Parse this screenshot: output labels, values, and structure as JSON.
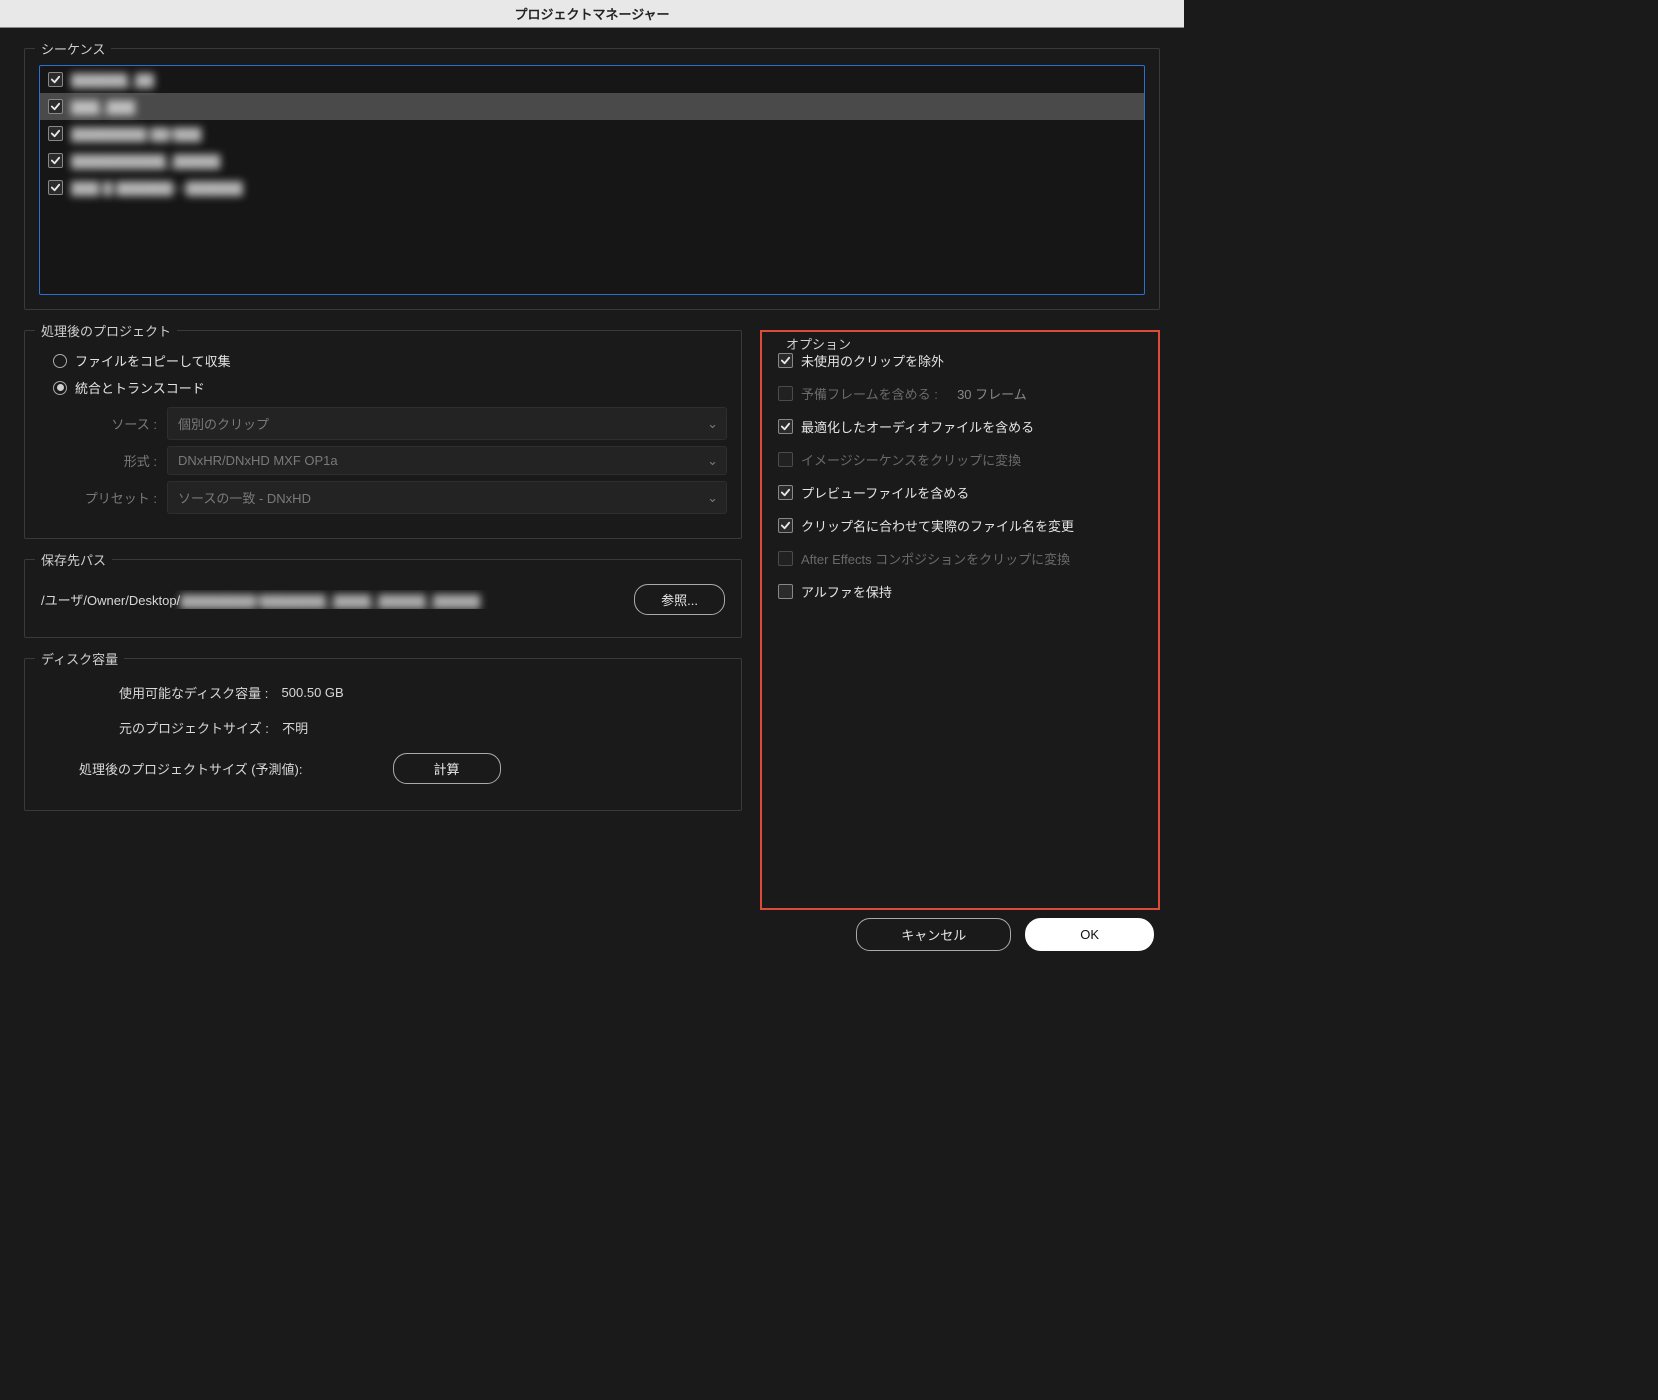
{
  "title": "プロジェクトマネージャー",
  "sequence": {
    "label": "シーケンス",
    "items": [
      {
        "label": "▓▓▓▓▓▓_▓▓",
        "checked": true,
        "selected": false
      },
      {
        "label": "▓▓▓_▓▓▓",
        "checked": true,
        "selected": true
      },
      {
        "label": "▓▓▓▓▓▓▓▓ ▓▓/▓▓▓",
        "checked": true,
        "selected": false
      },
      {
        "label": "▓▓▓▓▓▓▓▓▓▓_▓▓▓▓▓",
        "checked": true,
        "selected": false
      },
      {
        "label": "▓▓▓ ▓ ▓▓▓▓▓▓—▓▓▓▓▓▓",
        "checked": true,
        "selected": false
      }
    ]
  },
  "resulting": {
    "label": "処理後のプロジェクト",
    "radio_copy": "ファイルをコピーして収集",
    "radio_transcode": "統合とトランスコード",
    "selected": "transcode",
    "source_label": "ソース :",
    "source_value": "個別のクリップ",
    "format_label": "形式 :",
    "format_value": "DNxHR/DNxHD MXF OP1a",
    "preset_label": "プリセット :",
    "preset_value": "ソースの一致 - DNxHD"
  },
  "destination": {
    "label": "保存先パス",
    "path_prefix": "/ユーザ/Owner/Desktop/",
    "path_blur": "▓▓▓▓▓▓▓▓/▓▓▓▓▓▓▓_▓▓▓▓_▓▓▓▓▓_▓▓▓▓▓",
    "browse": "参照..."
  },
  "disk": {
    "label": "ディスク容量",
    "avail_label": "使用可能なディスク容量 :",
    "avail_value": "  500.50 GB",
    "orig_label": "元のプロジェクトサイズ :",
    "orig_value": "  不明",
    "result_label": "処理後のプロジェクトサイズ (予測値):",
    "calc": "計算"
  },
  "options": {
    "label": "オプション",
    "exclude_unused": {
      "label": "未使用のクリップを除外",
      "checked": true,
      "enabled": true
    },
    "include_handles": {
      "label": "予備フレームを含める :",
      "checked": false,
      "enabled": false,
      "extra": "  30 フレーム"
    },
    "include_audio": {
      "label": "最適化したオーディオファイルを含める",
      "checked": true,
      "enabled": true
    },
    "image_seq": {
      "label": "イメージシーケンスをクリップに変換",
      "checked": false,
      "enabled": false
    },
    "include_preview": {
      "label": "プレビューファイルを含める",
      "checked": true,
      "enabled": true
    },
    "rename_files": {
      "label": "クリップ名に合わせて実際のファイル名を変更",
      "checked": true,
      "enabled": true
    },
    "ae_comp": {
      "label": "After Effects コンポジションをクリップに変換",
      "checked": false,
      "enabled": false
    },
    "preserve_alpha": {
      "label": "アルファを保持",
      "checked": false,
      "enabled": true
    }
  },
  "footer": {
    "cancel": "キャンセル",
    "ok": "OK"
  }
}
